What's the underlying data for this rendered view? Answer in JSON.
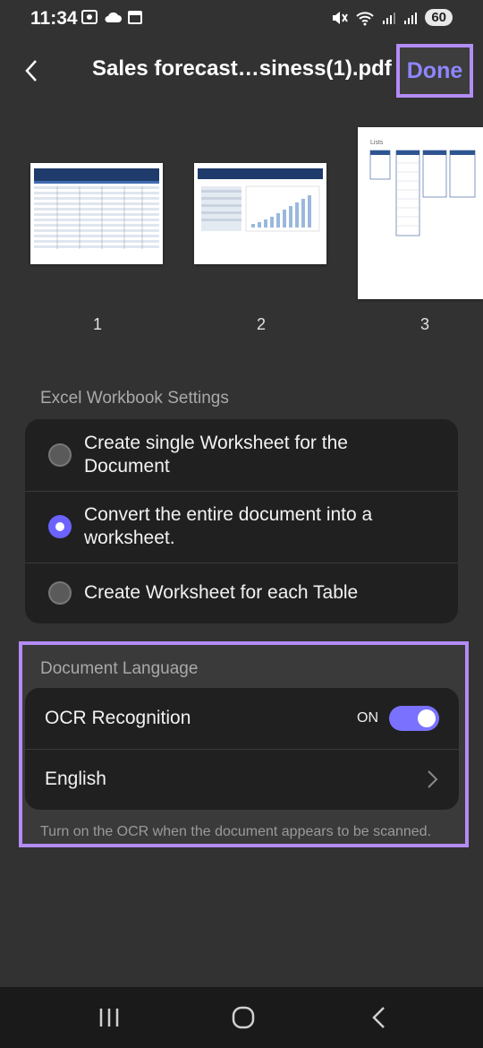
{
  "status": {
    "time": "11:34",
    "battery": "60"
  },
  "header": {
    "title": "Sales forecast…siness(1).pdf",
    "done_label": "Done"
  },
  "thumbnails": [
    {
      "page": "1"
    },
    {
      "page": "2"
    },
    {
      "page": "3",
      "heading": "Lists"
    }
  ],
  "excel_settings": {
    "title": "Excel Workbook Settings",
    "options": [
      {
        "label": "Create single Worksheet for the Document",
        "selected": false
      },
      {
        "label": "Convert the entire document into a worksheet.",
        "selected": true
      },
      {
        "label": "Create Worksheet for each Table",
        "selected": false
      }
    ]
  },
  "document_language": {
    "title": "Document Language",
    "ocr_label": "OCR Recognition",
    "ocr_state": "ON",
    "language": "English",
    "hint": "Turn on the OCR when the document appears to be scanned."
  },
  "colors": {
    "accent": "#7a72ff",
    "highlight": "#b38cf5",
    "background": "#323232"
  }
}
